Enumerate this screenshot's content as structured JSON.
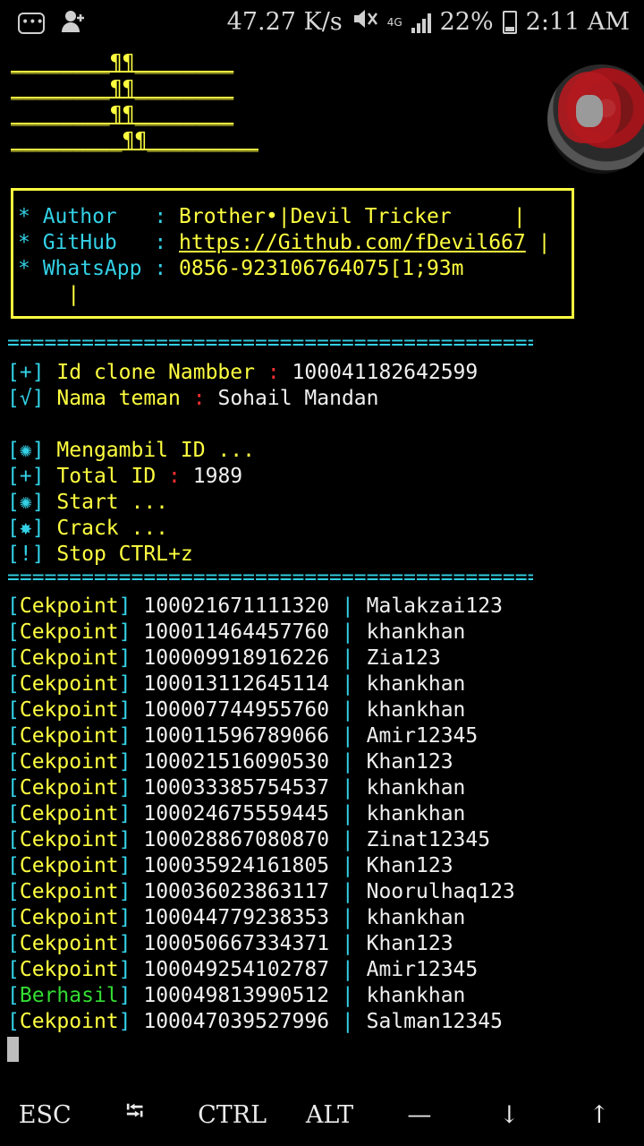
{
  "status_bar": {
    "speed": "47.27 K/s",
    "network": "4G",
    "battery": "22%",
    "time": "2:11 AM"
  },
  "banner": {
    "lines": [
      "________¶¶________",
      "________¶¶________",
      "________¶¶________",
      "_________¶¶_________"
    ]
  },
  "info": {
    "author_key": "* Author   : ",
    "author_val": "Brother•|Devil Tricker",
    "github_key": "* GitHub   : ",
    "github_val": "https://Github.com/fDevil667",
    "whatsapp_key": "* WhatsApp : ",
    "whatsapp_val": "0856-923106764075[1;93m"
  },
  "session": {
    "id_clone_prefix": "[+]",
    "id_clone_label": "Id clone Nambber",
    "id_clone_value": "100041182642599",
    "friend_prefix": "[√]",
    "friend_label": "Nama teman",
    "friend_value": "Sohail Mandan",
    "fetch_prefix": "[✺]",
    "fetch_label": "Mengambil ID ...",
    "total_prefix": "[+]",
    "total_label": "Total ID",
    "total_value": "1989",
    "start_prefix": "[✺]",
    "start_label": "Start ...",
    "crack_prefix": "[✸]",
    "crack_label": "Crack ...",
    "stop_prefix": "[!]",
    "stop_label": "Stop CTRL+z"
  },
  "results": [
    {
      "status": "Cekpoint",
      "id": "100021671111320",
      "pass": "Malakzai123"
    },
    {
      "status": "Cekpoint",
      "id": "100011464457760",
      "pass": "khankhan"
    },
    {
      "status": "Cekpoint",
      "id": "100009918916226",
      "pass": "Zia123"
    },
    {
      "status": "Cekpoint",
      "id": "100013112645114",
      "pass": "khankhan"
    },
    {
      "status": "Cekpoint",
      "id": "100007744955760",
      "pass": "khankhan"
    },
    {
      "status": "Cekpoint",
      "id": "100011596789066",
      "pass": "Amir12345"
    },
    {
      "status": "Cekpoint",
      "id": "100021516090530",
      "pass": "Khan123"
    },
    {
      "status": "Cekpoint",
      "id": "100033385754537",
      "pass": "khankhan"
    },
    {
      "status": "Cekpoint",
      "id": "100024675559445",
      "pass": "khankhan"
    },
    {
      "status": "Cekpoint",
      "id": "100028867080870",
      "pass": "Zinat12345"
    },
    {
      "status": "Cekpoint",
      "id": "100035924161805",
      "pass": "Khan123"
    },
    {
      "status": "Cekpoint",
      "id": "100036023863117",
      "pass": "Noorulhaq123"
    },
    {
      "status": "Cekpoint",
      "id": "100044779238353",
      "pass": "khankhan"
    },
    {
      "status": "Cekpoint",
      "id": "100050667334371",
      "pass": "Khan123"
    },
    {
      "status": "Cekpoint",
      "id": "100049254102787",
      "pass": "Amir12345"
    },
    {
      "status": "Berhasil",
      "id": "100049813990512",
      "pass": "khankhan"
    },
    {
      "status": "Cekpoint",
      "id": "100047039527996",
      "pass": "Salman12345"
    }
  ],
  "keys": [
    "ESC",
    "⭾",
    "CTRL",
    "ALT",
    "—",
    "↓",
    "↑"
  ],
  "colors": {
    "yellow": "#ffff40",
    "cyan": "#33d1e6",
    "red": "#ff3030",
    "green": "#33dd33"
  }
}
